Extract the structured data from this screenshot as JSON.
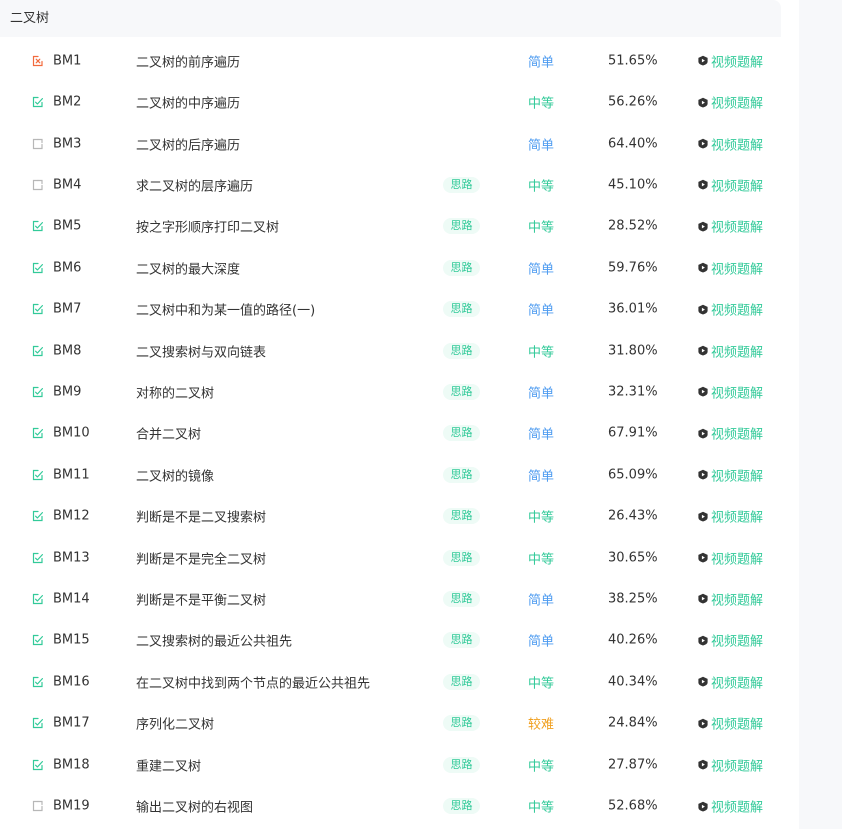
{
  "panel": {
    "title": "二叉树"
  },
  "colors": {
    "accent_green": "#32ca99",
    "easy_blue": "#4d9bf0",
    "hard_orange": "#f0a020",
    "started_red": "#f26a3d",
    "not_started_gray": "#b7b7b7"
  },
  "problems": [
    {
      "code": "BM1",
      "title": "二叉树的前序遍历",
      "hint": "",
      "difficulty": "简单",
      "level": "easy",
      "rate": "51.65%",
      "video": "视频题解",
      "status": "attempted"
    },
    {
      "code": "BM2",
      "title": "二叉树的中序遍历",
      "hint": "",
      "difficulty": "中等",
      "level": "medium",
      "rate": "56.26%",
      "video": "视频题解",
      "status": "solved"
    },
    {
      "code": "BM3",
      "title": "二叉树的后序遍历",
      "hint": "",
      "difficulty": "简单",
      "level": "easy",
      "rate": "64.40%",
      "video": "视频题解",
      "status": "none"
    },
    {
      "code": "BM4",
      "title": "求二叉树的层序遍历",
      "hint": "思路",
      "difficulty": "中等",
      "level": "medium",
      "rate": "45.10%",
      "video": "视频题解",
      "status": "none"
    },
    {
      "code": "BM5",
      "title": "按之字形顺序打印二叉树",
      "hint": "思路",
      "difficulty": "中等",
      "level": "medium",
      "rate": "28.52%",
      "video": "视频题解",
      "status": "solved"
    },
    {
      "code": "BM6",
      "title": "二叉树的最大深度",
      "hint": "思路",
      "difficulty": "简单",
      "level": "easy",
      "rate": "59.76%",
      "video": "视频题解",
      "status": "solved"
    },
    {
      "code": "BM7",
      "title": "二叉树中和为某一值的路径(一)",
      "hint": "思路",
      "difficulty": "简单",
      "level": "easy",
      "rate": "36.01%",
      "video": "视频题解",
      "status": "solved"
    },
    {
      "code": "BM8",
      "title": "二叉搜索树与双向链表",
      "hint": "思路",
      "difficulty": "中等",
      "level": "medium",
      "rate": "31.80%",
      "video": "视频题解",
      "status": "solved"
    },
    {
      "code": "BM9",
      "title": "对称的二叉树",
      "hint": "思路",
      "difficulty": "简单",
      "level": "easy",
      "rate": "32.31%",
      "video": "视频题解",
      "status": "solved"
    },
    {
      "code": "BM10",
      "title": "合并二叉树",
      "hint": "思路",
      "difficulty": "简单",
      "level": "easy",
      "rate": "67.91%",
      "video": "视频题解",
      "status": "solved"
    },
    {
      "code": "BM11",
      "title": "二叉树的镜像",
      "hint": "思路",
      "difficulty": "简单",
      "level": "easy",
      "rate": "65.09%",
      "video": "视频题解",
      "status": "solved"
    },
    {
      "code": "BM12",
      "title": "判断是不是二叉搜索树",
      "hint": "思路",
      "difficulty": "中等",
      "level": "medium",
      "rate": "26.43%",
      "video": "视频题解",
      "status": "solved"
    },
    {
      "code": "BM13",
      "title": "判断是不是完全二叉树",
      "hint": "思路",
      "difficulty": "中等",
      "level": "medium",
      "rate": "30.65%",
      "video": "视频题解",
      "status": "solved"
    },
    {
      "code": "BM14",
      "title": "判断是不是平衡二叉树",
      "hint": "思路",
      "difficulty": "简单",
      "level": "easy",
      "rate": "38.25%",
      "video": "视频题解",
      "status": "solved"
    },
    {
      "code": "BM15",
      "title": "二叉搜索树的最近公共祖先",
      "hint": "思路",
      "difficulty": "简单",
      "level": "easy",
      "rate": "40.26%",
      "video": "视频题解",
      "status": "solved"
    },
    {
      "code": "BM16",
      "title": "在二叉树中找到两个节点的最近公共祖先",
      "hint": "思路",
      "difficulty": "中等",
      "level": "medium",
      "rate": "40.34%",
      "video": "视频题解",
      "status": "solved"
    },
    {
      "code": "BM17",
      "title": "序列化二叉树",
      "hint": "思路",
      "difficulty": "较难",
      "level": "hard",
      "rate": "24.84%",
      "video": "视频题解",
      "status": "solved"
    },
    {
      "code": "BM18",
      "title": "重建二叉树",
      "hint": "思路",
      "difficulty": "中等",
      "level": "medium",
      "rate": "27.87%",
      "video": "视频题解",
      "status": "solved"
    },
    {
      "code": "BM19",
      "title": "输出二叉树的右视图",
      "hint": "思路",
      "difficulty": "中等",
      "level": "medium",
      "rate": "52.68%",
      "video": "视频题解",
      "status": "none"
    }
  ]
}
